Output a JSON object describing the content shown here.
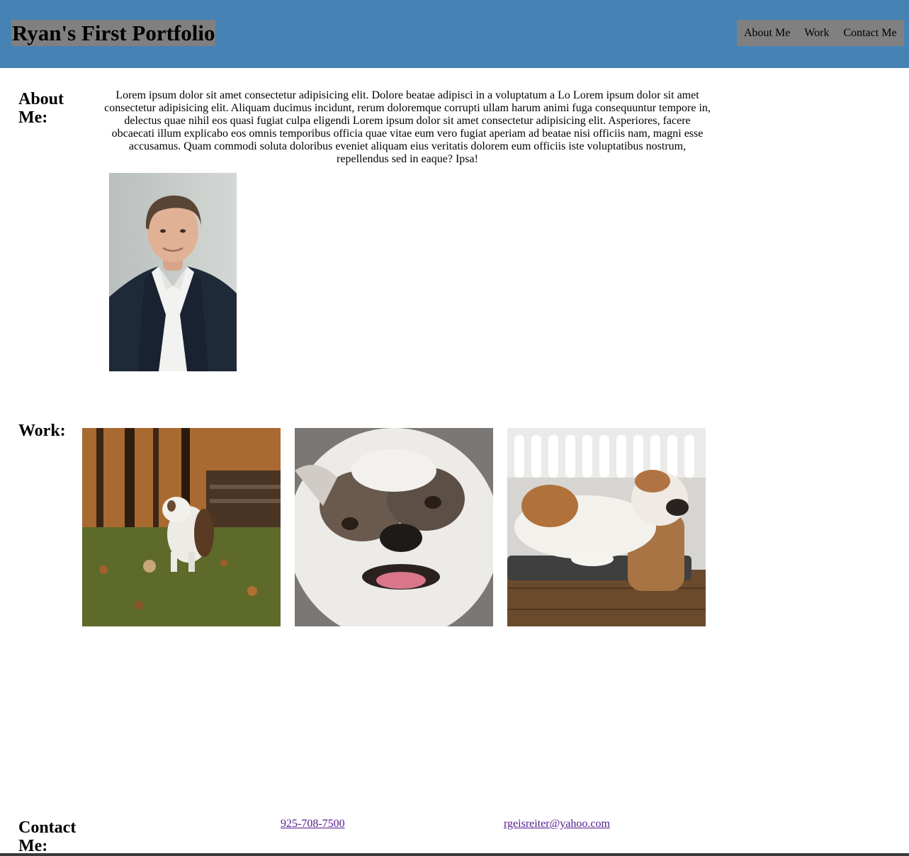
{
  "header": {
    "title": "Ryan's First Portfolio",
    "nav": [
      "About Me",
      "Work",
      "Contact Me"
    ]
  },
  "about": {
    "heading": "About Me:",
    "text": "Lorem ipsum dolor sit amet consectetur adipisicing elit. Dolore beatae adipisci in a voluptatum a Lo Lorem ipsum dolor sit amet consectetur adipisicing elit. Aliquam ducimus incidunt, rerum doloremque corrupti ullam harum animi fuga consequuntur tempore in, delectus quae nihil eos quasi fugiat culpa eligendi Lorem ipsum dolor sit amet consectetur adipisicing elit. Asperiores, facere obcaecati illum explicabo eos omnis temporibus officia quae vitae eum vero fugiat aperiam ad beatae nisi officiis nam, magni esse accusamus. Quam commodi soluta doloribus eveniet aliquam eius veritatis dolorem eum officiis iste voluptatibus nostrum, repellendus sed in eaque? Ipsa!"
  },
  "work": {
    "heading": "Work:"
  },
  "contact": {
    "heading": "Contact Me:",
    "phone": "925-708-7500",
    "email": "rgeisreiter@yahoo.com"
  },
  "colors": {
    "header_bg": "#4682b4",
    "title_bg": "#808080",
    "nav_bg": "#808080",
    "link": "#551a8b"
  }
}
